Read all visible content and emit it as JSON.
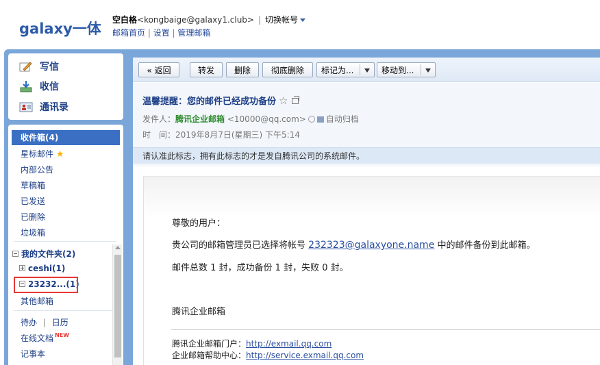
{
  "header": {
    "logo": "galaxy一体",
    "user_name": "空白格",
    "user_email": "<kongbaige@galaxy1.club>",
    "separator": "|",
    "switch_account": "切换帐号",
    "links": [
      "邮箱首页",
      "设置",
      "管理邮箱"
    ]
  },
  "compose": {
    "write": "写信",
    "receive": "收信",
    "contacts": "通讯录"
  },
  "sidebar": {
    "inbox": "收件箱(4)",
    "items": [
      "星标邮件",
      "内部公告",
      "草稿箱",
      "已发送",
      "已删除",
      "垃圾箱"
    ],
    "my_folders": "我的文件夹(2)",
    "folders": [
      "ceshi(1)",
      "23232...(1)"
    ],
    "other_mailbox": "其他邮箱",
    "todo": "待办",
    "calendar": "日历",
    "online_docs": "在线文档",
    "new_badge": "NEW",
    "notebook": "记事本"
  },
  "toolbar": {
    "back": "« 返回",
    "forward": "转发",
    "delete": "删除",
    "delete_forever": "彻底删除",
    "mark_as": "标记为...",
    "move_to": "移动到..."
  },
  "mail": {
    "subject": "温馨提醒：您的邮件已经成功备份",
    "from_label": "发件人：",
    "from_name": "腾讯企业邮箱",
    "from_addr": "<10000@qq.com>",
    "auto_archive": "自动归档",
    "time_label": "时　间：",
    "time_value": "2019年8月7日(星期三) 下午5:14",
    "notice": "请认准此标志，拥有此标志的才是发自腾讯公司的系统邮件。",
    "greeting": "尊敬的用户：",
    "line1_pre": "贵公司的邮箱管理员已选择将帐号",
    "line1_link": "232323@galaxyone.name",
    "line1_post": "中的邮件备份到此邮箱。",
    "line2": "邮件总数 1 封，成功备份 1 封，失败 0 封。",
    "signature": "腾讯企业邮箱",
    "portal_label": "腾讯企业邮箱门户：",
    "portal_url": "http://exmail.qq.com",
    "help_label": "企业邮箱帮助中心：",
    "help_url": "http://service.exmail.qq.com"
  }
}
